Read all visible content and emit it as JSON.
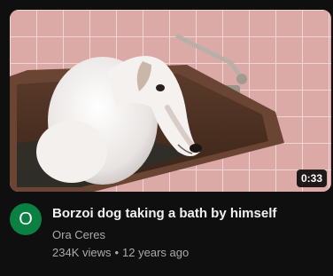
{
  "video": {
    "title": "Borzoi dog taking a bath by himself",
    "duration": "0:33",
    "thumbnail_icon": "borzoi-in-bathtub-thumbnail"
  },
  "channel": {
    "name": "Ora Ceres",
    "avatar_letter": "O",
    "avatar_color": "#0b8043"
  },
  "stats": {
    "views": "234K views",
    "separator": "•",
    "age": "12 years ago"
  },
  "colors": {
    "background": "#0f0f0f",
    "title": "#f1f1f1",
    "secondary_text": "#aaaaaa"
  }
}
